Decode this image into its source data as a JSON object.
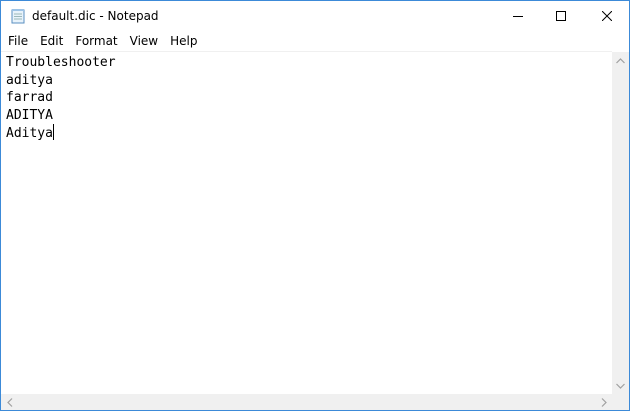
{
  "window": {
    "title": "default.dic - Notepad",
    "icon": "notepad-icon"
  },
  "caption_buttons": {
    "minimize": "minimize-icon",
    "maximize": "maximize-icon",
    "close": "close-icon"
  },
  "menu": {
    "items": [
      {
        "label": "File"
      },
      {
        "label": "Edit"
      },
      {
        "label": "Format"
      },
      {
        "label": "View"
      },
      {
        "label": "Help"
      }
    ]
  },
  "editor": {
    "lines": [
      "Troubleshooter",
      "aditya",
      "farrad",
      "ADITYA",
      "Aditya"
    ]
  },
  "colors": {
    "window_border": "#3c8ad8",
    "scrollbar_bg": "#f0f0f0"
  }
}
